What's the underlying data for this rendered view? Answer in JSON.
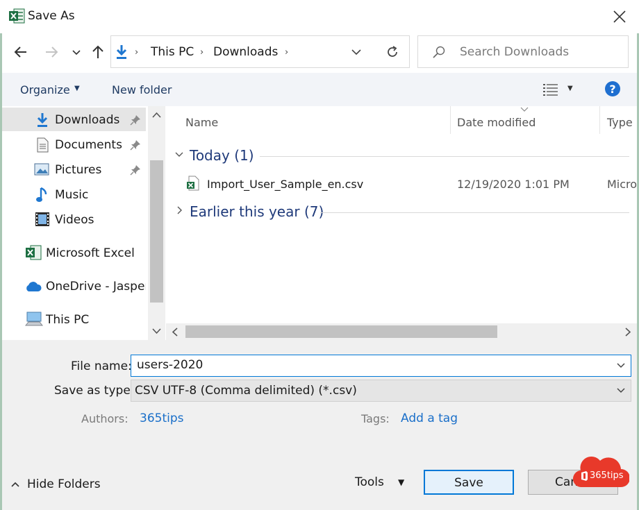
{
  "window": {
    "title": "Save As",
    "close_label": "Close"
  },
  "address": {
    "crumbs": [
      "This PC",
      "Downloads"
    ]
  },
  "search": {
    "placeholder": "Search Downloads"
  },
  "commands": {
    "organize": "Organize",
    "new_folder": "New folder"
  },
  "nav": {
    "items": [
      {
        "label": "Downloads"
      },
      {
        "label": "Documents"
      },
      {
        "label": "Pictures"
      },
      {
        "label": "Music"
      },
      {
        "label": "Videos"
      },
      {
        "label": "Microsoft Excel"
      },
      {
        "label": "OneDrive - Jasperl"
      },
      {
        "label": "This PC"
      }
    ]
  },
  "list": {
    "columns": {
      "name": "Name",
      "date": "Date modified",
      "type": "Type"
    },
    "groups": [
      {
        "title": "Today (1)"
      },
      {
        "title": "Earlier this year (7)"
      }
    ],
    "files": [
      {
        "name": "Import_User_Sample_en.csv",
        "date": "12/19/2020 1:01 PM",
        "type": "Micro"
      }
    ]
  },
  "form": {
    "file_name_label": "File name:",
    "file_name_value": "users-2020",
    "save_as_type_label": "Save as type:",
    "save_as_type_value": "CSV UTF-8 (Comma delimited) (*.csv)",
    "authors_label": "Authors:",
    "authors_value": "365tips",
    "tags_label": "Tags:",
    "tags_value": "Add a tag"
  },
  "footer": {
    "hide_folders": "Hide Folders",
    "tools": "Tools",
    "save": "Save",
    "cancel": "Can"
  },
  "badge": {
    "text": "365tips"
  },
  "colors": {
    "accent": "#0078d7",
    "link": "#1a6fc9",
    "group_title": "#1f3a7a",
    "excel_green": "#1d6f42",
    "badge_red": "#e8392a",
    "selection": "#e5e5e5"
  }
}
